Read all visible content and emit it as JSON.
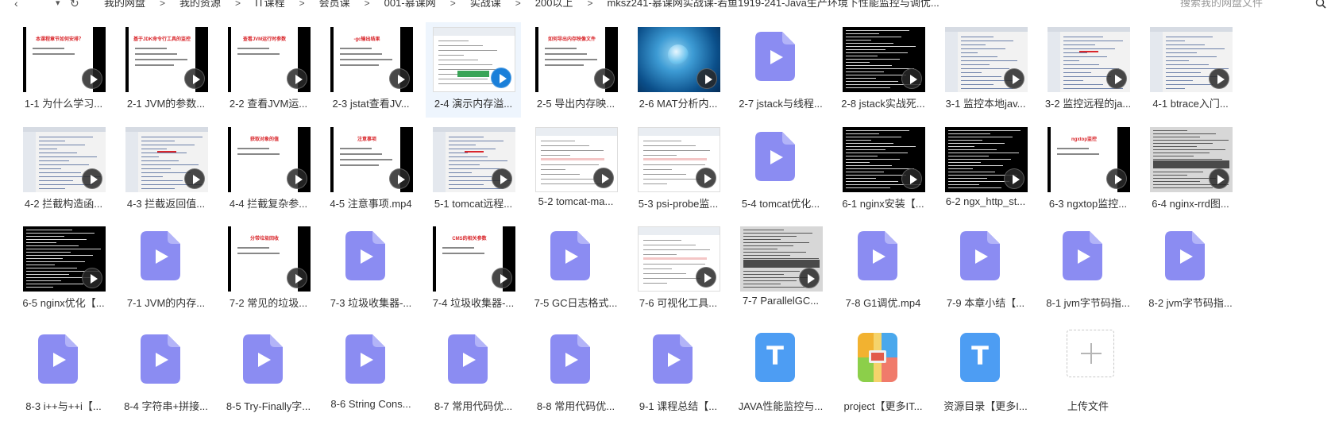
{
  "nav": {
    "back_glyph": "‹",
    "dropdown_glyph": "▾",
    "refresh_glyph": "↻"
  },
  "breadcrumbs": [
    "我的网盘",
    "我的资源",
    "IT课程",
    "会员课",
    "001-慕课网",
    "实战课",
    "200以上",
    "mksz241-慕课网实战课-若鱼1919-241-Java生产环境下性能监控与调优..."
  ],
  "breadcrumb_separator": ">",
  "search": {
    "placeholder": "搜索我的网盘文件"
  },
  "colors": {
    "video_icon": "#8b8cf2",
    "doc_icon": "#4d9df3",
    "selected_bg": "#eef5fd"
  },
  "files": [
    {
      "name": "1-1 为什么学习...",
      "thumb": "slide",
      "slide_title": "本课程章节如何安排？"
    },
    {
      "name": "2-1 JVM的参数...",
      "thumb": "slide",
      "slide_title": "基于JDK命令行工具的监控"
    },
    {
      "name": "2-2 查看JVM运...",
      "thumb": "slide",
      "slide_title": "查看JVM运行时参数"
    },
    {
      "name": "2-3 jstat查看JV...",
      "thumb": "slide",
      "slide_title": "-gc输出结果"
    },
    {
      "name": "2-4 演示内存溢...",
      "thumb": "web",
      "selected": true
    },
    {
      "name": "2-5 导出内存映...",
      "thumb": "slide",
      "slide_title": "如何导出内存映像文件"
    },
    {
      "name": "2-6 MAT分析内...",
      "thumb": "water"
    },
    {
      "name": "2-7 jstack与线程...",
      "thumb": "video-icon"
    },
    {
      "name": "2-8 jstack实战死...",
      "thumb": "code"
    },
    {
      "name": "3-1 监控本地jav...",
      "thumb": "ide"
    },
    {
      "name": "3-2 监控远程的ja...",
      "thumb": "ide"
    },
    {
      "name": "4-1 btrace入门...",
      "thumb": "ide"
    },
    {
      "name": "4-2 拦截构造函...",
      "thumb": "ide"
    },
    {
      "name": "4-3 拦截返回值...",
      "thumb": "ide"
    },
    {
      "name": "4-4 拦截复杂参...",
      "thumb": "slide",
      "slide_title": "获取对象的值"
    },
    {
      "name": "4-5 注意事项.mp4",
      "thumb": "slide",
      "slide_title": "注意事项"
    },
    {
      "name": "5-1 tomcat远程...",
      "thumb": "ide"
    },
    {
      "name": "5-2 tomcat-ma...",
      "thumb": "web"
    },
    {
      "name": "5-3 psi-probe监...",
      "thumb": "web"
    },
    {
      "name": "5-4 tomcat优化...",
      "thumb": "video-icon"
    },
    {
      "name": "6-1 nginx安装【...",
      "thumb": "code"
    },
    {
      "name": "6-2 ngx_http_st...",
      "thumb": "code"
    },
    {
      "name": "6-3 ngxtop监控...",
      "thumb": "slide",
      "slide_title": "ngxtop监控"
    },
    {
      "name": "6-4 nginx-rrd图...",
      "thumb": "gray"
    },
    {
      "name": "6-5 nginx优化【...",
      "thumb": "code"
    },
    {
      "name": "7-1 JVM的内存...",
      "thumb": "video-icon"
    },
    {
      "name": "7-2 常见的垃圾...",
      "thumb": "slide",
      "slide_title": "分带垃圾回收"
    },
    {
      "name": "7-3 垃圾收集器-...",
      "thumb": "video-icon"
    },
    {
      "name": "7-4 垃圾收集器-...",
      "thumb": "slide",
      "slide_title": "CMS的相关参数"
    },
    {
      "name": "7-5 GC日志格式...",
      "thumb": "video-icon"
    },
    {
      "name": "7-6 可视化工具...",
      "thumb": "web"
    },
    {
      "name": "7-7 ParallelGC...",
      "thumb": "gray"
    },
    {
      "name": "7-8 G1调优.mp4",
      "thumb": "video-icon"
    },
    {
      "name": "7-9 本章小结【...",
      "thumb": "video-icon"
    },
    {
      "name": "8-1 jvm字节码指...",
      "thumb": "video-icon"
    },
    {
      "name": "8-2 jvm字节码指...",
      "thumb": "video-icon"
    },
    {
      "name": "8-3 i++与++i【...",
      "thumb": "video-icon"
    },
    {
      "name": "8-4 字符串+拼接...",
      "thumb": "video-icon"
    },
    {
      "name": "8-5 Try-Finally字...",
      "thumb": "video-icon"
    },
    {
      "name": "8-6 String Cons...",
      "thumb": "video-icon"
    },
    {
      "name": "8-7 常用代码优...",
      "thumb": "video-icon"
    },
    {
      "name": "8-8 常用代码优...",
      "thumb": "video-icon"
    },
    {
      "name": "9-1 课程总结【...",
      "thumb": "video-icon"
    },
    {
      "name": "JAVA性能监控与...",
      "thumb": "doc-icon",
      "doc_letter": "T"
    },
    {
      "name": "project【更多IT...",
      "thumb": "zip-icon"
    },
    {
      "name": "资源目录【更多I...",
      "thumb": "doc-icon",
      "doc_letter": "T"
    },
    {
      "name": "上传文件",
      "thumb": "upload"
    }
  ]
}
